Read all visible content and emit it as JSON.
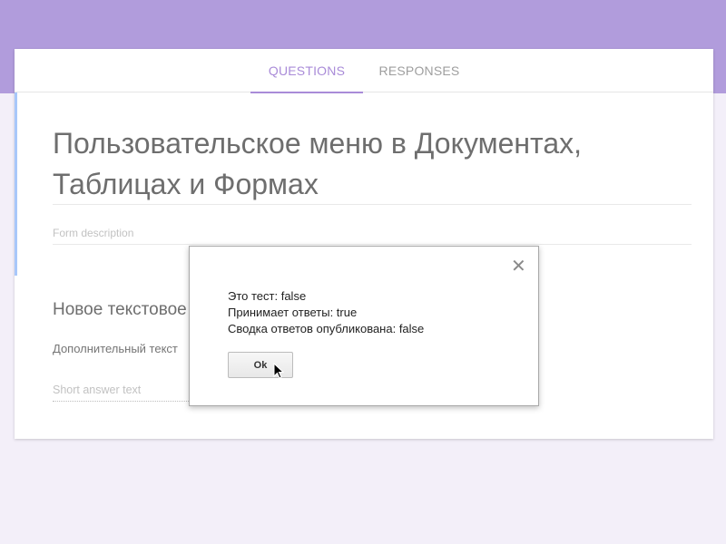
{
  "tabs": {
    "questions": "QUESTIONS",
    "responses": "RESPONSES",
    "active": "questions"
  },
  "form": {
    "title_line1": "Пользовательское меню в Документах,",
    "title_line2": "Таблицах и Формах",
    "description_placeholder": "Form description"
  },
  "question": {
    "title": "Новое текстовое поле",
    "help_text": "Дополнительный текст",
    "answer_placeholder": "Short answer text"
  },
  "dialog": {
    "line1": "Это тест: false",
    "line2": "Принимает ответы: true",
    "line3": "Сводка ответов опубликована: false",
    "ok_label": "Ok",
    "close_icon": "close-icon"
  },
  "colors": {
    "banner": "#b19cdc",
    "accent": "#a98bd8",
    "background": "#f3eff9",
    "left_accent": "#a8c7fa"
  }
}
